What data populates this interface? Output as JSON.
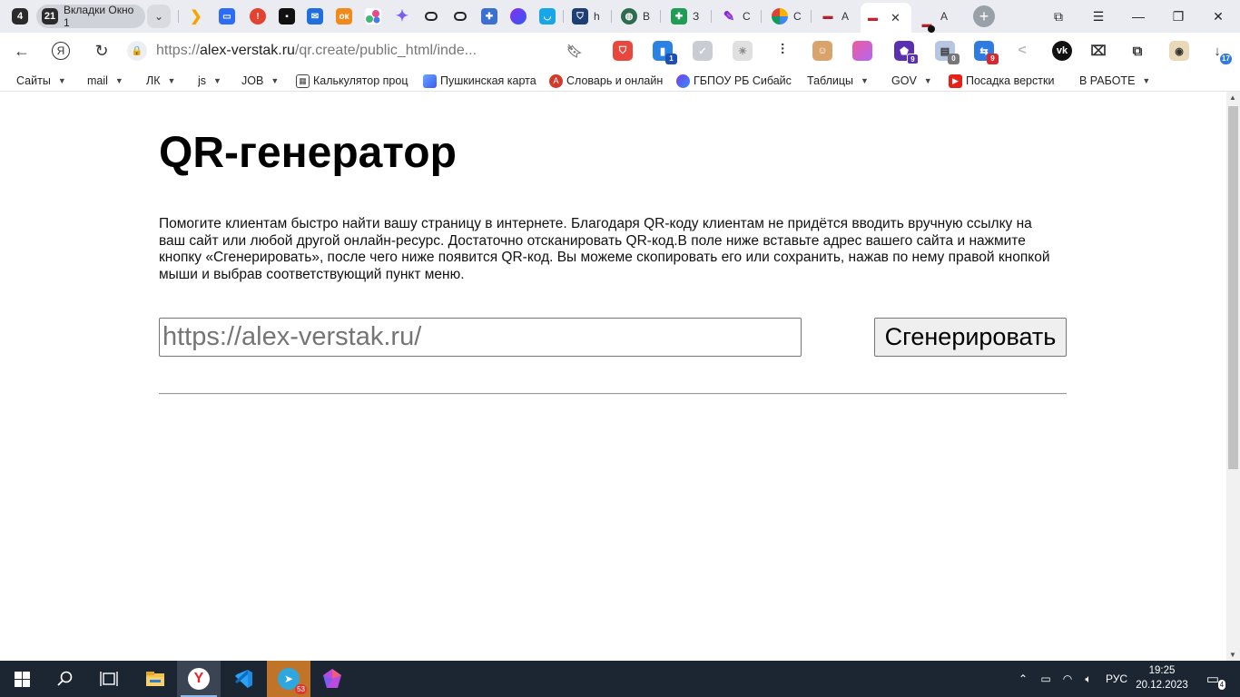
{
  "tabstrip": {
    "workspace_count": "4",
    "group": {
      "count": "21",
      "label": "Вкладки Окно 1"
    },
    "tabs": [
      {
        "icon": "play-arrow-icon",
        "label": ""
      },
      {
        "icon": "folder-icon",
        "label": ""
      },
      {
        "icon": "alert-icon",
        "label": ""
      },
      {
        "icon": "chat-bubble-icon",
        "label": ""
      },
      {
        "icon": "mail-icon",
        "label": ""
      },
      {
        "icon": "ok-icon",
        "label": ""
      },
      {
        "icon": "dots-icon",
        "label": ""
      },
      {
        "icon": "sparkle-icon",
        "label": ""
      },
      {
        "icon": "ring-icon",
        "label": ""
      },
      {
        "icon": "ring-icon",
        "label": ""
      },
      {
        "icon": "puzzle-icon",
        "label": ""
      },
      {
        "icon": "circle-gradient-icon",
        "label": ""
      },
      {
        "icon": "pocket-icon",
        "label": ""
      },
      {
        "icon": "shield-icon",
        "label": "h"
      },
      {
        "icon": "globe-icon",
        "label": "В"
      },
      {
        "icon": "sheets-icon",
        "label": "З"
      },
      {
        "icon": "pen-icon",
        "label": "С"
      },
      {
        "icon": "colorwheel-icon",
        "label": "С"
      },
      {
        "icon": "car-icon",
        "label": "А"
      },
      {
        "icon": "car-icon",
        "label": ""
      },
      {
        "icon": "car-icon",
        "label": "А"
      }
    ]
  },
  "toolbar": {
    "url_scheme": "https://",
    "url_domain": "alex-verstak.ru",
    "url_path": "/qr.create/public_html/inde...",
    "ext_badges": [
      "1",
      "9",
      "0",
      "9",
      "17"
    ]
  },
  "bookmarks": [
    {
      "label": "Сайты",
      "folder": true
    },
    {
      "label": "mail",
      "folder": true
    },
    {
      "label": "ЛК",
      "folder": true
    },
    {
      "label": "js",
      "folder": true
    },
    {
      "label": "JOB",
      "folder": true
    },
    {
      "label": "Калькулятор проц",
      "folder": false
    },
    {
      "label": "Пушкинская карта",
      "folder": false
    },
    {
      "label": "Словарь и онлайн",
      "folder": false
    },
    {
      "label": "ГБПОУ РБ Сибайс",
      "folder": false
    },
    {
      "label": "Таблицы",
      "folder": true
    },
    {
      "label": "GOV",
      "folder": true
    },
    {
      "label": "Посадка верстки",
      "folder": false
    },
    {
      "label": "В РАБОТЕ",
      "folder": true
    }
  ],
  "main": {
    "title": "QR-генератор",
    "description": "Помогите клиентам быстро найти вашу страницу в интернете. Благодаря QR-коду клиентам не придётся вводить вручную ссылку на ваш сайт или любой другой онлайн-ресурс. Достаточно отсканировать QR-код.В поле ниже вставьте адрес вашего сайта и нажмите кнопку «Сгенерировать», после чего ниже появится QR-код. Вы можеме скопировать его или сохранить, нажав по нему правой кнопкой мыши и выбрав соответствующий пункт меню.",
    "url_placeholder": "https://alex-verstak.ru/",
    "generate_label": "Сгенерировать"
  },
  "taskbar": {
    "telegram_badge": "53",
    "language": "РУС",
    "time": "19:25",
    "date": "20.12.2023",
    "notifications": "4"
  }
}
